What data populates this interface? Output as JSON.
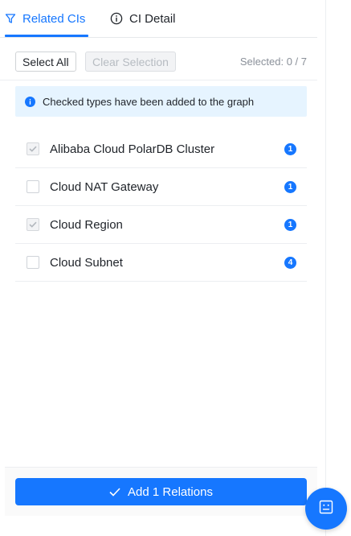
{
  "tabs": [
    {
      "label": "Related CIs",
      "icon": "filter-icon",
      "active": true
    },
    {
      "label": "CI Detail",
      "icon": "info-circle-icon",
      "active": false
    }
  ],
  "toolbar": {
    "select_all_label": "Select All",
    "clear_selection_label": "Clear Selection",
    "selected_text": "Selected: 0 / 7"
  },
  "info_banner": {
    "icon": "info-icon",
    "text": "Checked types have been added to the graph"
  },
  "types": [
    {
      "label": "Alibaba Cloud PolarDB Cluster",
      "count": "1",
      "checked": true,
      "disabled": true
    },
    {
      "label": "Cloud NAT Gateway",
      "count": "1",
      "checked": false,
      "disabled": false
    },
    {
      "label": "Cloud Region",
      "count": "1",
      "checked": true,
      "disabled": true
    },
    {
      "label": "Cloud Subnet",
      "count": "4",
      "checked": false,
      "disabled": false
    }
  ],
  "footer": {
    "primary_button_label": "Add 1 Relations",
    "primary_button_icon": "check-icon",
    "fab_icon": "assistant-icon"
  },
  "colors": {
    "accent": "#1677ff",
    "info_bg": "#e6f4ff"
  }
}
